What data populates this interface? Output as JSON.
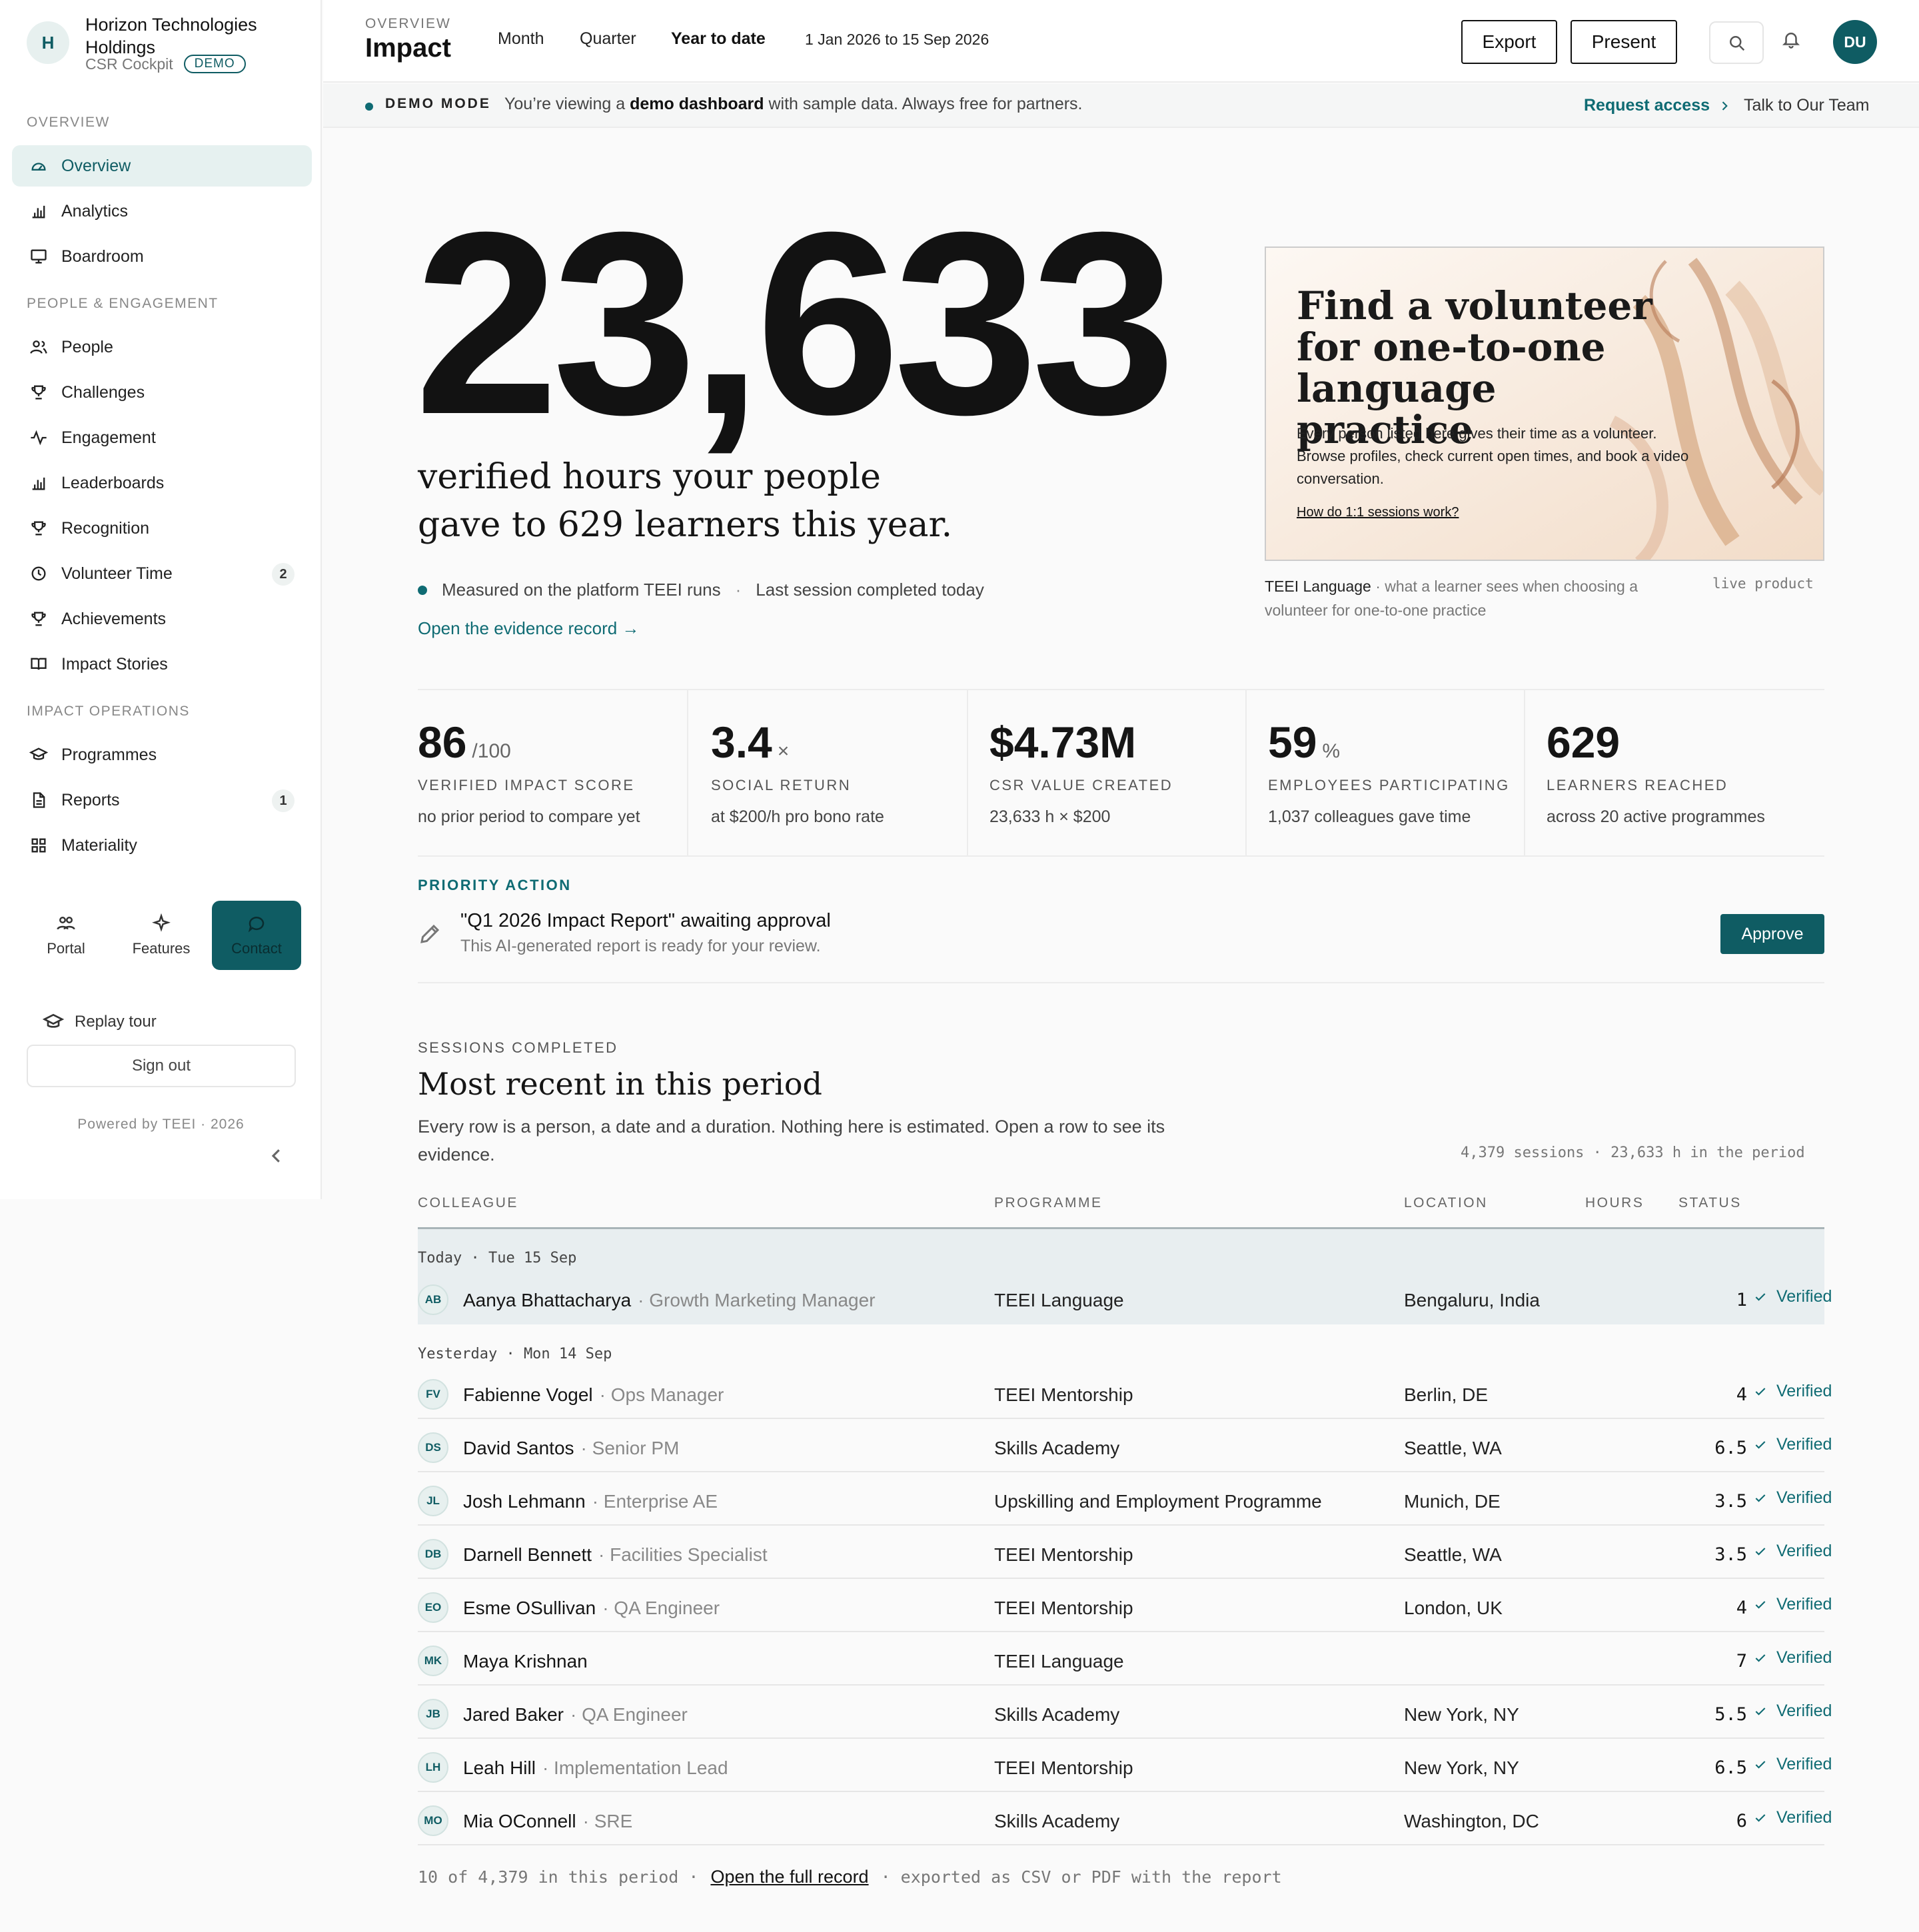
{
  "org": {
    "initial": "H",
    "name": "Horizon Technologies Holdings",
    "product": "CSR Cockpit",
    "badge": "DEMO"
  },
  "sidebar": {
    "sections": [
      "OVERVIEW",
      "PEOPLE & ENGAGEMENT",
      "IMPACT OPERATIONS"
    ],
    "items": [
      {
        "label": "Overview",
        "icon": "gauge-icon",
        "active": true
      },
      {
        "label": "Analytics",
        "icon": "bar-chart-icon"
      },
      {
        "label": "Boardroom",
        "icon": "presentation-icon"
      },
      {
        "label": "People",
        "icon": "users-icon"
      },
      {
        "label": "Challenges",
        "icon": "trophy-icon"
      },
      {
        "label": "Engagement",
        "icon": "activity-icon"
      },
      {
        "label": "Leaderboards",
        "icon": "bar-chart-icon"
      },
      {
        "label": "Recognition",
        "icon": "trophy-icon"
      },
      {
        "label": "Volunteer Time",
        "icon": "clock-icon",
        "count": "2"
      },
      {
        "label": "Achievements",
        "icon": "trophy-icon"
      },
      {
        "label": "Impact Stories",
        "icon": "book-icon"
      },
      {
        "label": "Programmes",
        "icon": "graduation-cap-icon"
      },
      {
        "label": "Reports",
        "icon": "file-icon",
        "count": "1"
      },
      {
        "label": "Materiality",
        "icon": "grid-icon"
      }
    ],
    "quick": [
      {
        "label": "Portal",
        "icon": "people-icon"
      },
      {
        "label": "Features",
        "icon": "sparkle-icon"
      },
      {
        "label": "Contact",
        "icon": "chat-bubble-icon"
      }
    ],
    "replay_tour": "Replay tour",
    "sign_out": "Sign out",
    "powered_by": "Powered by TEEI · 2026"
  },
  "topbar": {
    "eyebrow": "OVERVIEW",
    "title": "Impact",
    "tabs": [
      "Month",
      "Quarter",
      "Year to date"
    ],
    "active_tab": "Year to date",
    "date_range": "1 Jan 2026 to 15 Sep 2026",
    "export": "Export",
    "present": "Present",
    "user_initials": "DU"
  },
  "demo_strip": {
    "label": "DEMO MODE",
    "text_before": "You’re viewing a ",
    "text_bold": "demo dashboard",
    "text_after": " with sample data. Always free for partners.",
    "request_access": "Request access",
    "talk": "Talk to Our Team"
  },
  "hero": {
    "number": "23,633",
    "line1": "verified hours your people",
    "line2": "gave to 629 learners this year.",
    "measured": "Measured on the platform TEEI runs",
    "separator": "·",
    "last_session": "Last session completed today",
    "evidence_link": "Open the evidence record →"
  },
  "promo": {
    "title": "Find a volunteer for one-to-one language practice",
    "body": "Every person listed here gives their time as a volunteer. Browse profiles, check current open times, and book a video conversation.",
    "link": "How do 1:1 sessions work?",
    "caption_bold": "TEEI Language",
    "caption_rest": " · what a learner sees when choosing a volunteer for one-to-one practice",
    "tag": "live product"
  },
  "kpis": [
    {
      "value": "86",
      "suffix": "/100",
      "label": "VERIFIED IMPACT SCORE",
      "note": "no prior period to compare yet"
    },
    {
      "value": "3.4",
      "suffix": "×",
      "label": "SOCIAL RETURN",
      "note": "at $200/h pro bono rate"
    },
    {
      "value": "$4.73M",
      "suffix": "",
      "label": "CSR VALUE CREATED",
      "note": "23,633 h × $200"
    },
    {
      "value": "59",
      "suffix": "%",
      "label": "EMPLOYEES PARTICIPATING",
      "note": "1,037 colleagues gave time"
    },
    {
      "value": "629",
      "suffix": "",
      "label": "LEARNERS REACHED",
      "note": "across 20 active programmes"
    }
  ],
  "priority": {
    "label": "PRIORITY ACTION",
    "title": "\"Q1 2026 Impact Report\" awaiting approval",
    "subtitle": "This AI-generated report is ready for your review.",
    "button": "Approve"
  },
  "sessions": {
    "eyebrow": "SESSIONS COMPLETED",
    "title": "Most recent in this period",
    "description": "Every row is a person, a date and a duration. Nothing here is estimated. Open a row to see its evidence.",
    "count": "4,379 sessions · 23,633 h in the period",
    "headers": [
      "COLLEAGUE",
      "PROGRAMME",
      "LOCATION",
      "HOURS",
      "STATUS"
    ],
    "groups": [
      {
        "label": "Today · Tue 15 Sep",
        "rows": [
          {
            "initials": "AB",
            "name": "Aanya Bhattacharya",
            "role": "· Growth Marketing Manager",
            "programme": "TEEI Language",
            "location": "Bengaluru, India",
            "hours": "1",
            "status": "Verified"
          }
        ]
      },
      {
        "label": "Yesterday · Mon 14 Sep",
        "rows": [
          {
            "initials": "FV",
            "name": "Fabienne Vogel",
            "role": "· Ops Manager",
            "programme": "TEEI Mentorship",
            "location": "Berlin, DE",
            "hours": "4",
            "status": "Verified"
          },
          {
            "initials": "DS",
            "name": "David Santos",
            "role": "· Senior PM",
            "programme": "Skills Academy",
            "location": "Seattle, WA",
            "hours": "6.5",
            "status": "Verified"
          },
          {
            "initials": "JL",
            "name": "Josh Lehmann",
            "role": "· Enterprise AE",
            "programme": "Upskilling and Employment Programme",
            "location": "Munich, DE",
            "hours": "3.5",
            "status": "Verified"
          },
          {
            "initials": "DB",
            "name": "Darnell Bennett",
            "role": "· Facilities Specialist",
            "programme": "TEEI Mentorship",
            "location": "Seattle, WA",
            "hours": "3.5",
            "status": "Verified"
          },
          {
            "initials": "EO",
            "name": "Esme OSullivan",
            "role": "· QA Engineer",
            "programme": "TEEI Mentorship",
            "location": "London, UK",
            "hours": "4",
            "status": "Verified"
          },
          {
            "initials": "MK",
            "name": "Maya Krishnan",
            "role": "",
            "programme": "TEEI Language",
            "location": "",
            "hours": "7",
            "status": "Verified"
          },
          {
            "initials": "JB",
            "name": "Jared Baker",
            "role": "· QA Engineer",
            "programme": "Skills Academy",
            "location": "New York, NY",
            "hours": "5.5",
            "status": "Verified"
          },
          {
            "initials": "LH",
            "name": "Leah Hill",
            "role": "· Implementation Lead",
            "programme": "TEEI Mentorship",
            "location": "New York, NY",
            "hours": "6.5",
            "status": "Verified"
          },
          {
            "initials": "MO",
            "name": "Mia OConnell",
            "role": "· SRE",
            "programme": "Skills Academy",
            "location": "Washington, DC",
            "hours": "6",
            "status": "Verified"
          }
        ]
      }
    ],
    "footer_before": "10 of 4,379 in this period ·",
    "footer_link": "Open the full record",
    "footer_after": "· exported as CSV or PDF with the report"
  },
  "colors": {
    "accent": "#0f5c63",
    "accent_text": "#0f6b73"
  }
}
